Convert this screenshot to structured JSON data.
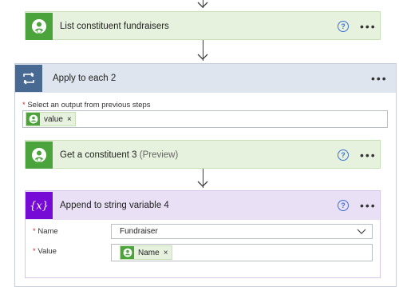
{
  "cards": {
    "list_fundraisers": {
      "title": "List constituent fundraisers",
      "help": "?",
      "more": "•••"
    },
    "apply_each": {
      "title": "Apply to each 2",
      "more": "•••"
    },
    "get_constituent": {
      "title": "Get a constituent 3",
      "preview": "(Preview)",
      "help": "?",
      "more": "•••"
    },
    "append_var": {
      "title": "Append to string variable 4",
      "help": "?",
      "more": "•••"
    }
  },
  "apply_each_fields": {
    "select_output_label": "Select an output from previous steps",
    "required_mark": "*",
    "token_value": "value",
    "token_remove": "×"
  },
  "append_fields": {
    "name_label": "Name",
    "name_value": "Fundraiser",
    "value_label": "Value",
    "value_token": "Name",
    "token_remove": "×",
    "required_mark": "*"
  },
  "icons": {
    "connector": "person-check-icon",
    "loop": "loop-icon",
    "variable": "variable-x-icon",
    "chevron": "chevron-down-icon"
  },
  "colors": {
    "connector_green": "#4aa33b",
    "connector_bg": "#e6f2dd",
    "loop_blue": "#486991",
    "variable_purple": "#770bd6"
  }
}
